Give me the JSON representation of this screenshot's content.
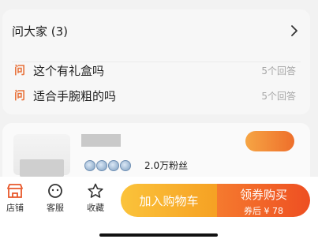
{
  "qa": {
    "title": "问大家 (3)",
    "badge": "问",
    "questions": [
      {
        "text": "这个有礼盒吗",
        "answers": "5个回答"
      },
      {
        "text": "适合手腕粗的吗",
        "answers": "5个回答"
      }
    ]
  },
  "shop": {
    "fans": "2.0万粉丝"
  },
  "bottom_bar": {
    "store_label": "店铺",
    "service_label": "客服",
    "favorite_label": "收藏",
    "add_to_cart": "加入购物车",
    "coupon_buy": "领券购买",
    "coupon_price": "券后 ¥ 78"
  },
  "colors": {
    "accent_orange": "#ee5c24",
    "question_badge": "#e8733c",
    "cart_yellow": "#fbc33b"
  }
}
